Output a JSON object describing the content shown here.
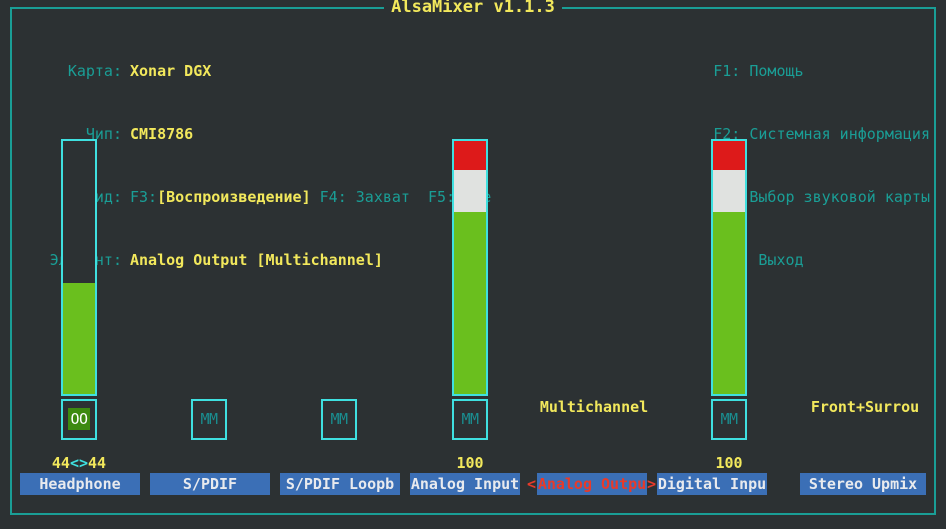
{
  "window": {
    "title": "AlsaMixer v1.1.3"
  },
  "header": {
    "labels": {
      "card": "Карта:",
      "chip": "Чип:",
      "view": "Вид:",
      "item": "Элемент:"
    },
    "values": {
      "card": "Xonar DGX",
      "chip": "CMI8786",
      "item": "Analog Output [Multichannel]"
    },
    "view": {
      "f3_key": "F3:",
      "f3_label": "[Воспроизведение]",
      "f4": "F4: Захват",
      "f5": "F5: Все"
    },
    "help": [
      "F1: Помощь",
      "F2: Системная информация",
      "F6: Выбор звуковой карты",
      "Esc: Выход"
    ]
  },
  "channels": [
    {
      "name": "Headphone",
      "value": "44<>44",
      "value_left": "44",
      "value_sep": "<>",
      "value_right": "44",
      "has_bar": true,
      "fill_percent": 44,
      "mute_label": "OO",
      "muted": false,
      "selected": false
    },
    {
      "name": "S/PDIF",
      "value": "",
      "has_bar": false,
      "fill_percent": 0,
      "mute_label": "MM",
      "muted": true,
      "selected": false
    },
    {
      "name": "S/PDIF Loopb",
      "value": "",
      "has_bar": false,
      "fill_percent": 0,
      "mute_label": "MM",
      "muted": true,
      "selected": false
    },
    {
      "name": "Analog Input",
      "value": "100",
      "has_bar": true,
      "fill_percent": 100,
      "mute_label": "MM",
      "muted": true,
      "selected": false
    },
    {
      "name": "Analog Outpu",
      "value": "",
      "has_bar": false,
      "fill_percent": 0,
      "mute_label": "",
      "muted": false,
      "selected": true,
      "marker_left": "<",
      "marker_right": ">",
      "free_label": "Multichannel"
    },
    {
      "name": "Digital Inpu",
      "value": "100",
      "has_bar": true,
      "fill_percent": 100,
      "mute_label": "MM",
      "muted": true,
      "selected": false
    },
    {
      "name": "Stereo Upmix",
      "value": "",
      "has_bar": false,
      "fill_percent": 0,
      "mute_label": "",
      "muted": false,
      "selected": false,
      "free_label": "Front+Surrou"
    }
  ],
  "colors": {
    "background": "#2c3133",
    "frame": "#1a9e96",
    "accent_cyan": "#3fe0e0",
    "yellow": "#f2e85c",
    "teal": "#1a9e96",
    "bar_green": "#6abf1e",
    "bar_white": "#e0e2e0",
    "bar_red": "#dd1a1a",
    "label_blue": "#3b6fb6",
    "selected_red": "#e83a2a"
  }
}
